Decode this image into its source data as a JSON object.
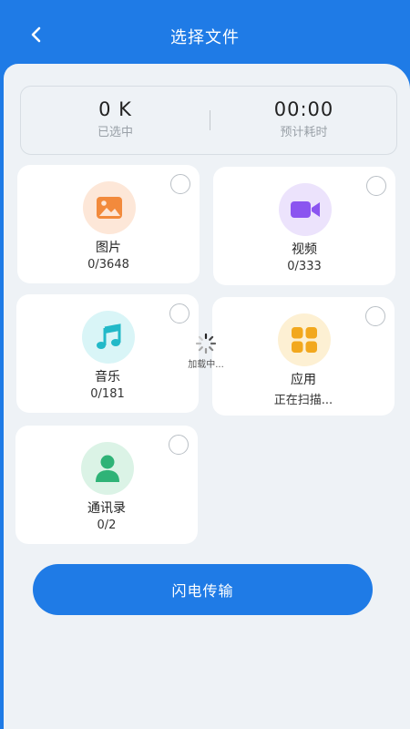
{
  "header": {
    "title": "选择文件"
  },
  "summary": {
    "size_value": "0 K",
    "size_label": "已选中",
    "time_value": "00:00",
    "time_label": "预计耗时"
  },
  "categories": [
    {
      "name": "图片",
      "count": "0/3648",
      "icon": "image-icon",
      "color": "#f28a3c",
      "bg": "#fde7d8"
    },
    {
      "name": "视频",
      "count": "0/333",
      "icon": "video-icon",
      "color": "#8b55f0",
      "bg": "#ece3fc"
    },
    {
      "name": "音乐",
      "count": "0/181",
      "icon": "music-icon",
      "color": "#22b9c8",
      "bg": "#d9f5f7"
    },
    {
      "name": "应用",
      "count": "正在扫描...",
      "icon": "apps-icon",
      "color": "#f2a81e",
      "bg": "#fdf0d3"
    },
    {
      "name": "通讯录",
      "count": "0/2",
      "icon": "contact-icon",
      "color": "#2fb377",
      "bg": "#dbf3e6"
    }
  ],
  "loading": {
    "label": "加载中..."
  },
  "action": {
    "label": "闪电传输"
  }
}
